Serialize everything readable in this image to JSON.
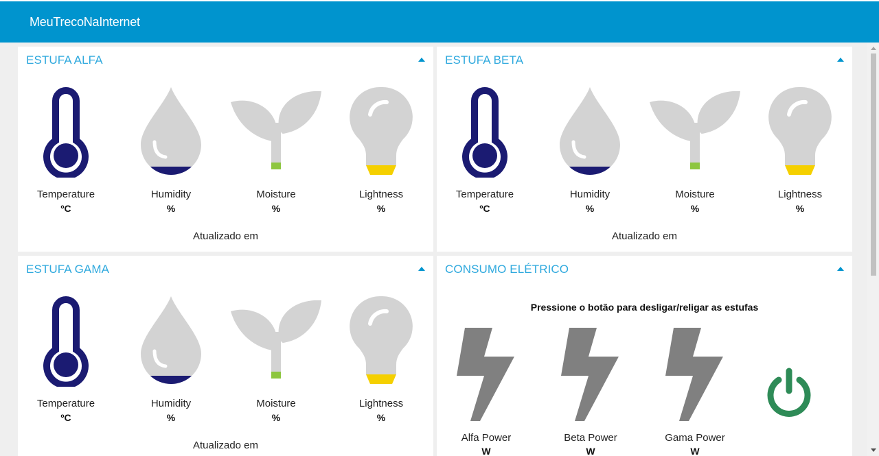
{
  "app": {
    "title": "MeuTrecoNaInternet"
  },
  "greenhouses": [
    {
      "title": "ESTUFA ALFA",
      "sensors": [
        {
          "label": "Temperature",
          "unit": "ºC"
        },
        {
          "label": "Humidity",
          "unit": "%"
        },
        {
          "label": "Moisture",
          "unit": "%"
        },
        {
          "label": "Lightness",
          "unit": "%"
        }
      ],
      "updated": "Atualizado em"
    },
    {
      "title": "ESTUFA BETA",
      "sensors": [
        {
          "label": "Temperature",
          "unit": "ºC"
        },
        {
          "label": "Humidity",
          "unit": "%"
        },
        {
          "label": "Moisture",
          "unit": "%"
        },
        {
          "label": "Lightness",
          "unit": "%"
        }
      ],
      "updated": "Atualizado em"
    },
    {
      "title": "ESTUFA GAMA",
      "sensors": [
        {
          "label": "Temperature",
          "unit": "ºC"
        },
        {
          "label": "Humidity",
          "unit": "%"
        },
        {
          "label": "Moisture",
          "unit": "%"
        },
        {
          "label": "Lightness",
          "unit": "%"
        }
      ],
      "updated": "Atualizado em"
    }
  ],
  "consumo": {
    "title": "CONSUMO ELÉTRICO",
    "message": "Pressione o botão para desligar/religar as estufas",
    "meters": [
      {
        "label": "Alfa Power",
        "unit": "W"
      },
      {
        "label": "Beta Power",
        "unit": "W"
      },
      {
        "label": "Gama Power",
        "unit": "W"
      }
    ],
    "power_button_icon": "power-icon"
  },
  "colors": {
    "header": "#0094ce",
    "title": "#2fa9de",
    "thermometer": "#1b1b72",
    "icon_gray": "#d3d3d3",
    "moisture_fill": "#8dc63f",
    "light_fill": "#f5d000",
    "bolt": "#808080",
    "power_button": "#2e8b57"
  },
  "icons": [
    "thermometer-icon",
    "droplet-icon",
    "sprout-icon",
    "bulb-icon",
    "lightning-icon",
    "power-icon"
  ]
}
